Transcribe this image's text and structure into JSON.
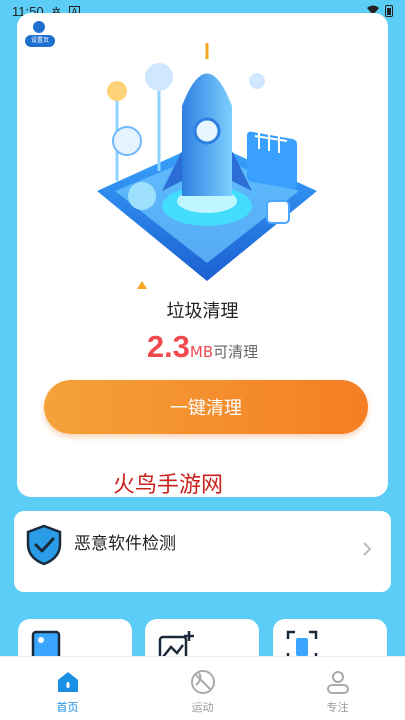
{
  "status": {
    "time": "11:50",
    "icon_a": "A"
  },
  "main": {
    "user_tag": "设置页",
    "title": "垃圾清理",
    "size_value": "2.3",
    "size_unit": "MB",
    "size_suffix": "可清理",
    "button_label": "一键清理",
    "watermark": "火鸟手游网"
  },
  "malware": {
    "label": "恶意软件检测"
  },
  "tabs": [
    {
      "label": "首页",
      "icon": "home-icon"
    },
    {
      "label": "运动",
      "icon": "ball-icon"
    },
    {
      "label": "专注",
      "icon": "person-icon"
    }
  ],
  "colors": {
    "accent": "#1a8fe3",
    "background": "#5bcdf6",
    "size": "#f14b50",
    "button": "#f57d24"
  }
}
